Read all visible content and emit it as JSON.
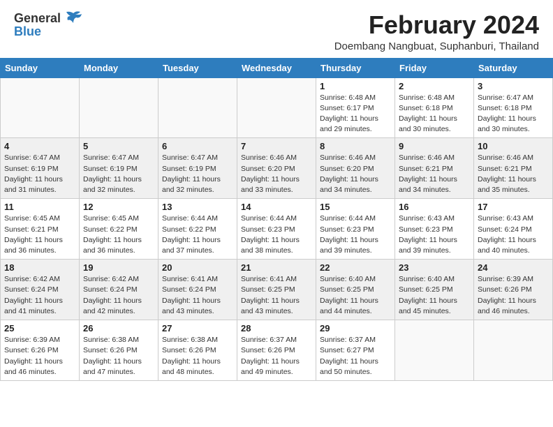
{
  "header": {
    "logo_general": "General",
    "logo_blue": "Blue",
    "main_title": "February 2024",
    "subtitle": "Doembang Nangbuat, Suphanburi, Thailand"
  },
  "calendar": {
    "days_of_week": [
      "Sunday",
      "Monday",
      "Tuesday",
      "Wednesday",
      "Thursday",
      "Friday",
      "Saturday"
    ],
    "weeks": [
      [
        {
          "day": "",
          "info": ""
        },
        {
          "day": "",
          "info": ""
        },
        {
          "day": "",
          "info": ""
        },
        {
          "day": "",
          "info": ""
        },
        {
          "day": "1",
          "info": "Sunrise: 6:48 AM\nSunset: 6:17 PM\nDaylight: 11 hours and 29 minutes."
        },
        {
          "day": "2",
          "info": "Sunrise: 6:48 AM\nSunset: 6:18 PM\nDaylight: 11 hours and 30 minutes."
        },
        {
          "day": "3",
          "info": "Sunrise: 6:47 AM\nSunset: 6:18 PM\nDaylight: 11 hours and 30 minutes."
        }
      ],
      [
        {
          "day": "4",
          "info": "Sunrise: 6:47 AM\nSunset: 6:19 PM\nDaylight: 11 hours and 31 minutes."
        },
        {
          "day": "5",
          "info": "Sunrise: 6:47 AM\nSunset: 6:19 PM\nDaylight: 11 hours and 32 minutes."
        },
        {
          "day": "6",
          "info": "Sunrise: 6:47 AM\nSunset: 6:19 PM\nDaylight: 11 hours and 32 minutes."
        },
        {
          "day": "7",
          "info": "Sunrise: 6:46 AM\nSunset: 6:20 PM\nDaylight: 11 hours and 33 minutes."
        },
        {
          "day": "8",
          "info": "Sunrise: 6:46 AM\nSunset: 6:20 PM\nDaylight: 11 hours and 34 minutes."
        },
        {
          "day": "9",
          "info": "Sunrise: 6:46 AM\nSunset: 6:21 PM\nDaylight: 11 hours and 34 minutes."
        },
        {
          "day": "10",
          "info": "Sunrise: 6:46 AM\nSunset: 6:21 PM\nDaylight: 11 hours and 35 minutes."
        }
      ],
      [
        {
          "day": "11",
          "info": "Sunrise: 6:45 AM\nSunset: 6:21 PM\nDaylight: 11 hours and 36 minutes."
        },
        {
          "day": "12",
          "info": "Sunrise: 6:45 AM\nSunset: 6:22 PM\nDaylight: 11 hours and 36 minutes."
        },
        {
          "day": "13",
          "info": "Sunrise: 6:44 AM\nSunset: 6:22 PM\nDaylight: 11 hours and 37 minutes."
        },
        {
          "day": "14",
          "info": "Sunrise: 6:44 AM\nSunset: 6:23 PM\nDaylight: 11 hours and 38 minutes."
        },
        {
          "day": "15",
          "info": "Sunrise: 6:44 AM\nSunset: 6:23 PM\nDaylight: 11 hours and 39 minutes."
        },
        {
          "day": "16",
          "info": "Sunrise: 6:43 AM\nSunset: 6:23 PM\nDaylight: 11 hours and 39 minutes."
        },
        {
          "day": "17",
          "info": "Sunrise: 6:43 AM\nSunset: 6:24 PM\nDaylight: 11 hours and 40 minutes."
        }
      ],
      [
        {
          "day": "18",
          "info": "Sunrise: 6:42 AM\nSunset: 6:24 PM\nDaylight: 11 hours and 41 minutes."
        },
        {
          "day": "19",
          "info": "Sunrise: 6:42 AM\nSunset: 6:24 PM\nDaylight: 11 hours and 42 minutes."
        },
        {
          "day": "20",
          "info": "Sunrise: 6:41 AM\nSunset: 6:24 PM\nDaylight: 11 hours and 43 minutes."
        },
        {
          "day": "21",
          "info": "Sunrise: 6:41 AM\nSunset: 6:25 PM\nDaylight: 11 hours and 43 minutes."
        },
        {
          "day": "22",
          "info": "Sunrise: 6:40 AM\nSunset: 6:25 PM\nDaylight: 11 hours and 44 minutes."
        },
        {
          "day": "23",
          "info": "Sunrise: 6:40 AM\nSunset: 6:25 PM\nDaylight: 11 hours and 45 minutes."
        },
        {
          "day": "24",
          "info": "Sunrise: 6:39 AM\nSunset: 6:26 PM\nDaylight: 11 hours and 46 minutes."
        }
      ],
      [
        {
          "day": "25",
          "info": "Sunrise: 6:39 AM\nSunset: 6:26 PM\nDaylight: 11 hours and 46 minutes."
        },
        {
          "day": "26",
          "info": "Sunrise: 6:38 AM\nSunset: 6:26 PM\nDaylight: 11 hours and 47 minutes."
        },
        {
          "day": "27",
          "info": "Sunrise: 6:38 AM\nSunset: 6:26 PM\nDaylight: 11 hours and 48 minutes."
        },
        {
          "day": "28",
          "info": "Sunrise: 6:37 AM\nSunset: 6:26 PM\nDaylight: 11 hours and 49 minutes."
        },
        {
          "day": "29",
          "info": "Sunrise: 6:37 AM\nSunset: 6:27 PM\nDaylight: 11 hours and 50 minutes."
        },
        {
          "day": "",
          "info": ""
        },
        {
          "day": "",
          "info": ""
        }
      ]
    ]
  }
}
